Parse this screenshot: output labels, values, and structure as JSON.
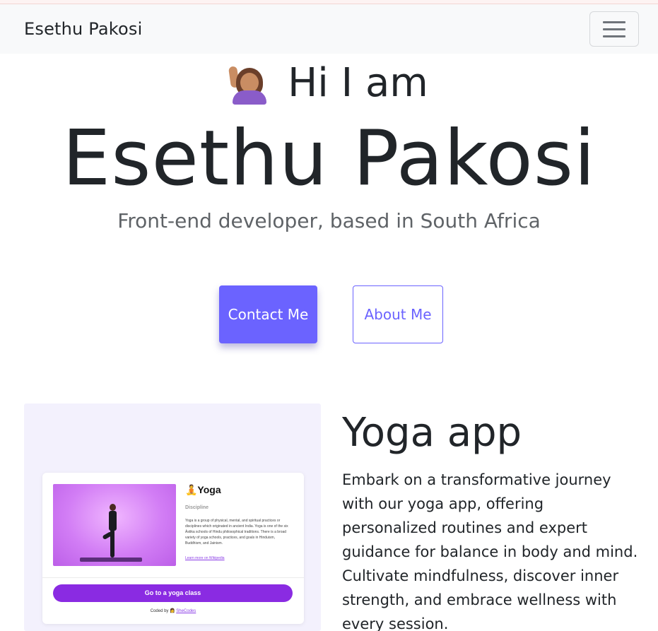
{
  "navbar": {
    "brand": "Esethu Pakosi",
    "toggler_icon": "hamburger-menu-icon"
  },
  "hero": {
    "greeting_emoji": "woman-raising-hand-emoji",
    "greeting": "Hi I am",
    "name": "Esethu Pakosi",
    "tagline": "Front-end developer, based in South Africa",
    "contact_label": "Contact Me",
    "about_label": "About Me"
  },
  "colors": {
    "accent": "#6b63ff",
    "navbar_bg": "#f8f9fa",
    "card_bg": "#f3f1fd"
  },
  "project": {
    "title": "Yoga app",
    "description": "Embark on a transformative journey with our yoga app, offering personalized routines and expert guidance for balance in body and mind. Cultivate mindfulness, discover inner strength, and embrace wellness with every session.",
    "preview": {
      "title": "🧘Yoga",
      "label": "Discipline",
      "text": "Yoga is a group of physical, mental, and spiritual practices or disciplines which originated in ancient India. Yoga is one of the six Āstika schools of Hindu philosophical traditions. There is a broad variety of yoga schools, practices, and goals in Hinduism, Buddhism, and Jainism.",
      "link": "Learn more on Wikipedia",
      "button": "Go to a yoga class",
      "footer_prefix": "Coded by 👩 ",
      "footer_link": "SheCodes"
    }
  }
}
